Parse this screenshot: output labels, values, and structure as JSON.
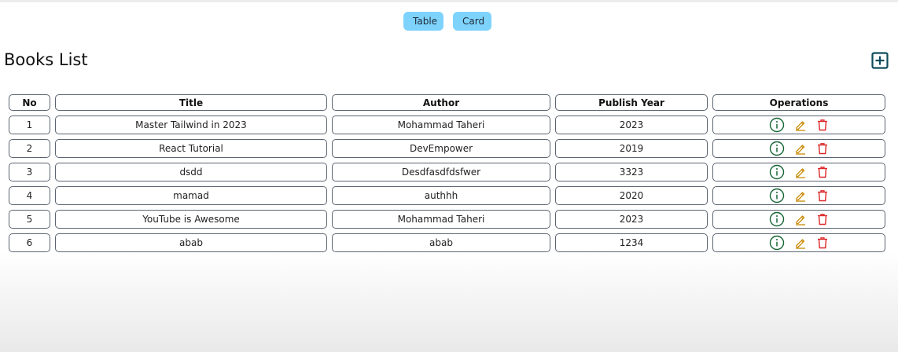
{
  "view_toggle": {
    "table_label": "Table",
    "card_label": "Card"
  },
  "page": {
    "title": "Books List"
  },
  "table": {
    "headers": [
      "No",
      "Title",
      "Author",
      "Publish Year",
      "Operations"
    ],
    "rows": [
      {
        "no": "1",
        "title": "Master Tailwind in 2023",
        "author": "Mohammad Taheri",
        "year": "2023"
      },
      {
        "no": "2",
        "title": "React Tutorial",
        "author": "DevEmpower",
        "year": "2019"
      },
      {
        "no": "3",
        "title": "dsdd",
        "author": "Desdfasdfdsfwer",
        "year": "3323"
      },
      {
        "no": "4",
        "title": "mamad",
        "author": "authhh",
        "year": "2020"
      },
      {
        "no": "5",
        "title": "YouTube is Awesome",
        "author": "Mohammad Taheri",
        "year": "2023"
      },
      {
        "no": "6",
        "title": "abab",
        "author": "abab",
        "year": "1234"
      }
    ]
  },
  "icons": {
    "add": "plus-square-icon",
    "info": "info-circle-icon",
    "edit": "pencil-icon",
    "delete": "trash-icon"
  },
  "colors": {
    "button_bg": "#7dd3fc",
    "add_icon": "#0f4c5c",
    "info_icon": "#166534",
    "edit_icon": "#ca8a04",
    "delete_icon": "#dc2626",
    "cell_border": "#5b6470"
  }
}
